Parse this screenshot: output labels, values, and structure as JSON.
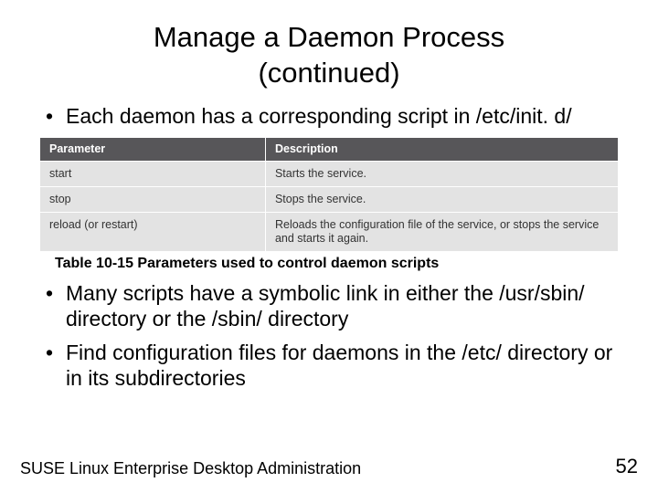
{
  "title_line1": "Manage a Daemon Process",
  "title_line2": "(continued)",
  "bullets_top": [
    "Each daemon has a corresponding script in /etc/init. d/"
  ],
  "table": {
    "headers": [
      "Parameter",
      "Description"
    ],
    "rows": [
      [
        "start",
        "Starts the service."
      ],
      [
        "stop",
        "Stops the service."
      ],
      [
        "reload (or restart)",
        "Reloads the configuration file of the service, or stops the service and starts it again."
      ]
    ]
  },
  "caption": "Table 10-15 Parameters used to control daemon scripts",
  "bullets_bottom": [
    "Many scripts have a symbolic link in either the /usr/sbin/ directory or the /sbin/ directory",
    "Find configuration files for daemons in the /etc/ directory or in its subdirectories"
  ],
  "footer_left": "SUSE Linux Enterprise Desktop Administration",
  "footer_right": "52"
}
